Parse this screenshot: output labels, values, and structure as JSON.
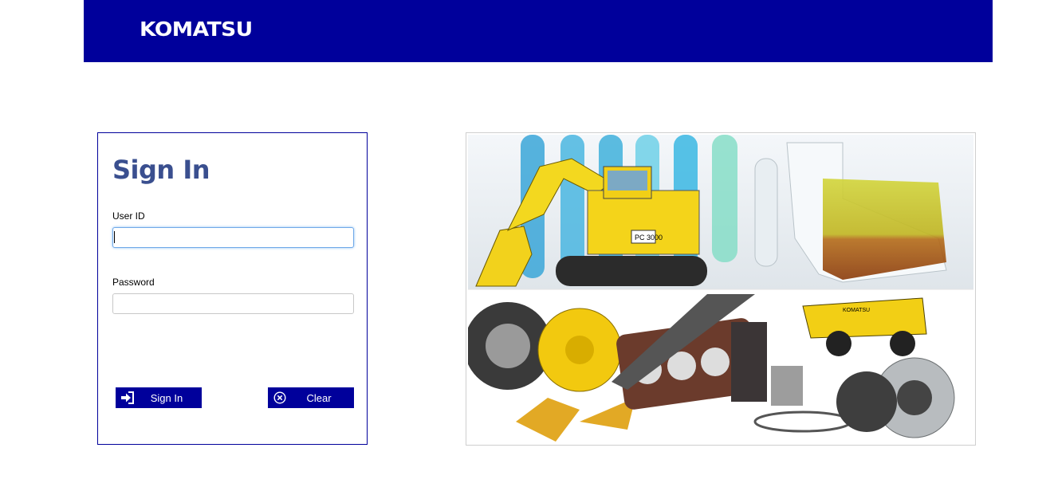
{
  "header": {
    "logo_text": "KOMATSU",
    "bg_color": "#00009b"
  },
  "login": {
    "title": "Sign In",
    "user_id_label": "User ID",
    "user_id_value": "",
    "password_label": "Password",
    "password_value": "",
    "signin_label": "Sign In",
    "clear_label": "Clear",
    "title_color": "#3a4f8f"
  },
  "hero": {
    "truck_badge_text": "KOMATSU",
    "excavator_model": "PC 3000"
  }
}
